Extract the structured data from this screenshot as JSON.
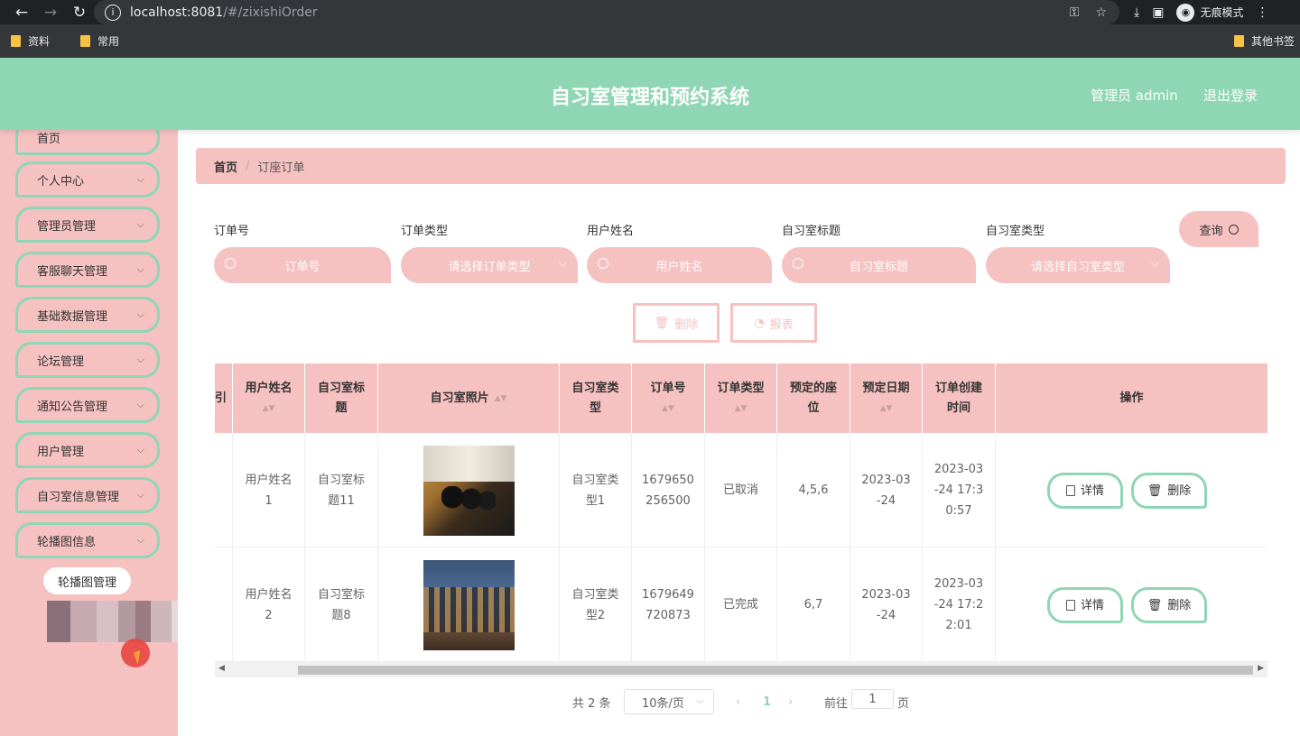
{
  "browser": {
    "url_host": "localhost:8081",
    "url_path": "/#/zixishiOrder",
    "incognito_label": "无痕模式",
    "bookmarks": [
      "资料",
      "常用"
    ],
    "other_bookmarks": "其他书签"
  },
  "header": {
    "title": "自习室管理和预约系统",
    "user": "管理员 admin",
    "logout": "退出登录"
  },
  "sidebar": {
    "items": [
      "首页",
      "个人中心",
      "管理员管理",
      "客服聊天管理",
      "基础数据管理",
      "论坛管理",
      "通知公告管理",
      "用户管理",
      "自习室信息管理",
      "轮播图信息"
    ],
    "submenu": "轮播图管理"
  },
  "breadcrumb": {
    "home": "首页",
    "separator": "/",
    "current": "订座订单"
  },
  "filters": [
    {
      "label": "订单号",
      "placeholder": "订单号"
    },
    {
      "label": "订单类型",
      "placeholder": "请选择订单类型"
    },
    {
      "label": "用户姓名",
      "placeholder": "用户姓名"
    },
    {
      "label": "自习室标题",
      "placeholder": "自习室标题"
    },
    {
      "label": "自习室类型",
      "placeholder": "请选择自习室类型"
    }
  ],
  "actions": {
    "query": "查询",
    "delete": "删除",
    "report": "报表"
  },
  "table": {
    "headers": [
      "用户姓名",
      "自习室标题",
      "自习室照片",
      "自习室类型",
      "订单号",
      "订单类型",
      "预定的座位",
      "预定日期",
      "订单创建时间",
      "操作"
    ],
    "header_cut": "引",
    "rows": [
      {
        "user": [
          "用户姓名",
          "1"
        ],
        "title": [
          "自习室标",
          "题11"
        ],
        "type": [
          "自习室类",
          "型1"
        ],
        "order_no": [
          "1679650",
          "256500"
        ],
        "order_type": "已取消",
        "seats": "4,5,6",
        "date": [
          "2023-03",
          "-24"
        ],
        "created": [
          "2023-03",
          "-24 17:3",
          "0:57"
        ]
      },
      {
        "user": [
          "用户姓名",
          "2"
        ],
        "title": [
          "自习室标",
          "题8"
        ],
        "type": [
          "自习室类",
          "型2"
        ],
        "order_no": [
          "1679649",
          "720873"
        ],
        "order_type": "已完成",
        "seats": "6,7",
        "date": [
          "2023-03",
          "-24"
        ],
        "created": [
          "2023-03",
          "-24 17:2",
          "2:01"
        ]
      }
    ],
    "row_actions": {
      "detail": "详情",
      "delete": "删除"
    }
  },
  "pagination": {
    "total": "共 2 条",
    "page_size": "10条/页",
    "current_page": "1",
    "goto_label": "前往",
    "goto_value": "1",
    "page_unit": "页"
  },
  "colors": {
    "header_green": "#8fd6b4",
    "sidebar_pink": "#f6c1c1"
  }
}
